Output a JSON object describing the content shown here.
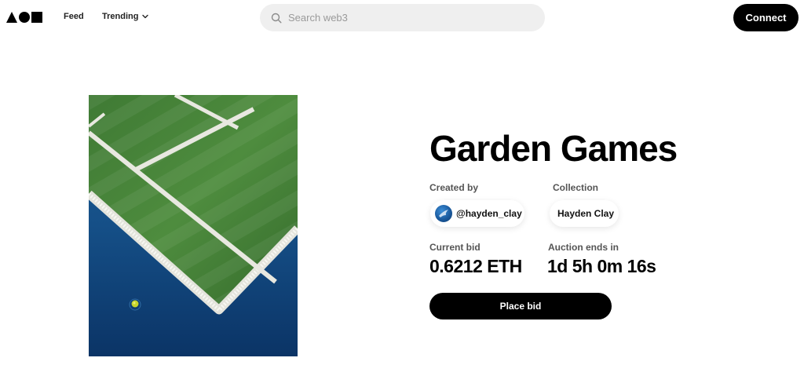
{
  "header": {
    "logo_icon": "shapes-logo-icon",
    "nav": {
      "feed_label": "Feed",
      "trending_label": "Trending"
    },
    "search": {
      "placeholder": "Search web3",
      "value": ""
    },
    "connect_label": "Connect"
  },
  "artwork": {
    "icon": "tennis-court-artwork-image"
  },
  "details": {
    "title": "Garden Games",
    "created_by_label": "Created by",
    "creator_handle": "@hayden_clay",
    "collection_label": "Collection",
    "collection_name": "Hayden Clay",
    "current_bid_label": "Current bid",
    "current_bid_value": "0.6212 ETH",
    "auction_label": "Auction ends in",
    "auction_value": "1d 5h 0m 16s",
    "place_bid_label": "Place bid"
  },
  "colors": {
    "primary": "#000000",
    "search_bg": "#efefef",
    "text_muted": "#555555"
  }
}
